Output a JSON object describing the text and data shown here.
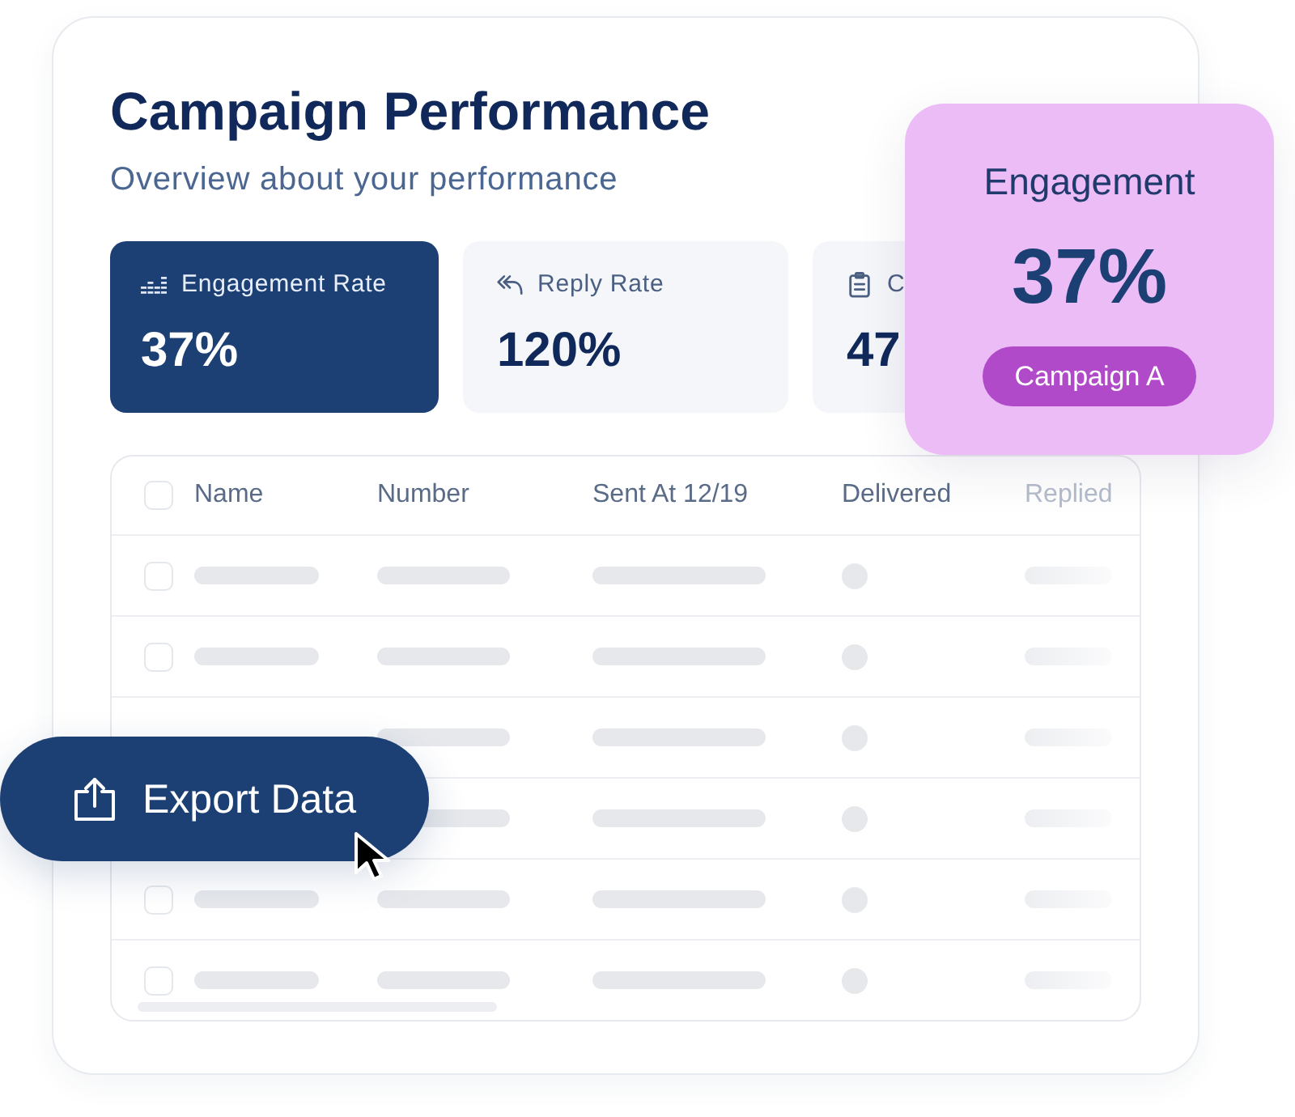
{
  "header": {
    "title": "Campaign Performance",
    "subtitle": "Overview about your performance"
  },
  "stat_cards": [
    {
      "label": "Engagement Rate",
      "value": "37%",
      "selected": true
    },
    {
      "label": "Reply Rate",
      "value": "120%",
      "selected": false
    },
    {
      "label": "C",
      "value": "47",
      "selected": false
    }
  ],
  "table": {
    "header_checked": false,
    "columns": [
      "Name",
      "Number",
      "Sent At 12/19",
      "Delivered",
      "Replied"
    ],
    "rows": [
      {
        "kind": "full",
        "checked": false
      },
      {
        "kind": "full",
        "checked": false
      },
      {
        "kind": "covered"
      },
      {
        "kind": "covered"
      },
      {
        "kind": "full",
        "checked": false
      },
      {
        "kind": "full",
        "checked": false
      }
    ]
  },
  "export_button": {
    "label": "Export Data"
  },
  "engagement_popup": {
    "title": "Engagement",
    "value": "37%",
    "tag": "Campaign A"
  }
}
